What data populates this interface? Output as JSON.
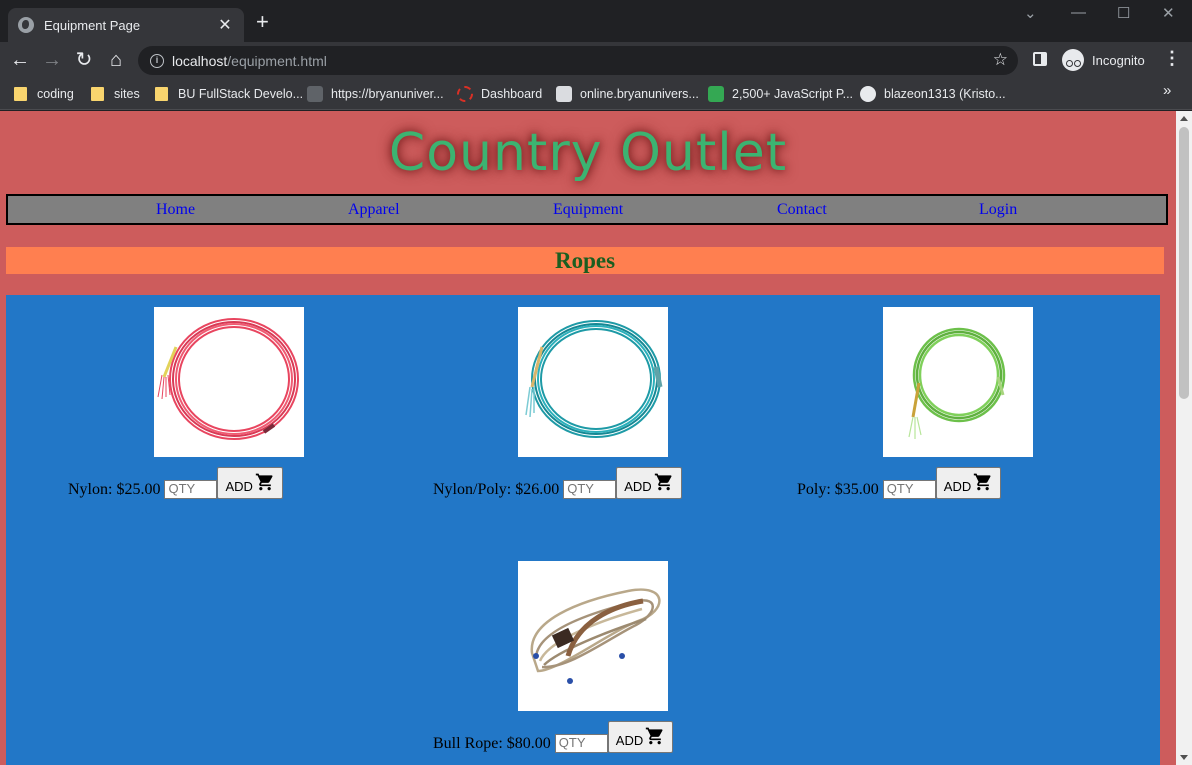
{
  "browser": {
    "tab_title": "Equipment Page",
    "url_host": "localhost",
    "url_path": "/equipment.html",
    "profile_label": "Incognito",
    "bookmarks": [
      {
        "label": "coding",
        "type": "folder"
      },
      {
        "label": "sites",
        "type": "folder"
      },
      {
        "label": "BU FullStack Develo...",
        "type": "folder"
      },
      {
        "label": "https://bryanuniver...",
        "type": "site",
        "icon": "mountain-icon"
      },
      {
        "label": "Dashboard",
        "type": "site",
        "icon": "dashboard-icon"
      },
      {
        "label": "online.bryanunivers...",
        "type": "site",
        "icon": "seal-icon"
      },
      {
        "label": "2,500+ JavaScript P...",
        "type": "site",
        "icon": "js-icon"
      },
      {
        "label": "blazeon1313 (Kristo...",
        "type": "site",
        "icon": "github-icon"
      }
    ]
  },
  "page": {
    "site_title": "Country Outlet",
    "nav": [
      "Home",
      "Apparel",
      "Equipment",
      "Contact",
      "Login"
    ],
    "section_title": "Ropes",
    "qty_placeholder": "QTY",
    "add_label": "ADD",
    "products": [
      {
        "label": "Nylon: $25.00",
        "rope_color": "#e8455f",
        "image": "red coiled lariat rope"
      },
      {
        "label": "Nylon/Poly: $26.00",
        "rope_color": "#1e9aa6",
        "image": "teal coiled lariat rope"
      },
      {
        "label": "Poly: $35.00",
        "rope_color": "#6cc04a",
        "image": "green coiled lariat rope"
      },
      {
        "label": "Bull Rope: $80.00",
        "rope_color": "#b9a88a",
        "image": "tan braided bull rope"
      }
    ]
  },
  "colors": {
    "page_bg": "#cd5c5c",
    "title": "#3cb371",
    "nav_bg": "#808080",
    "section_bar": "#ff7f50",
    "products_bg": "#2277c7",
    "link": "#0000ee"
  }
}
